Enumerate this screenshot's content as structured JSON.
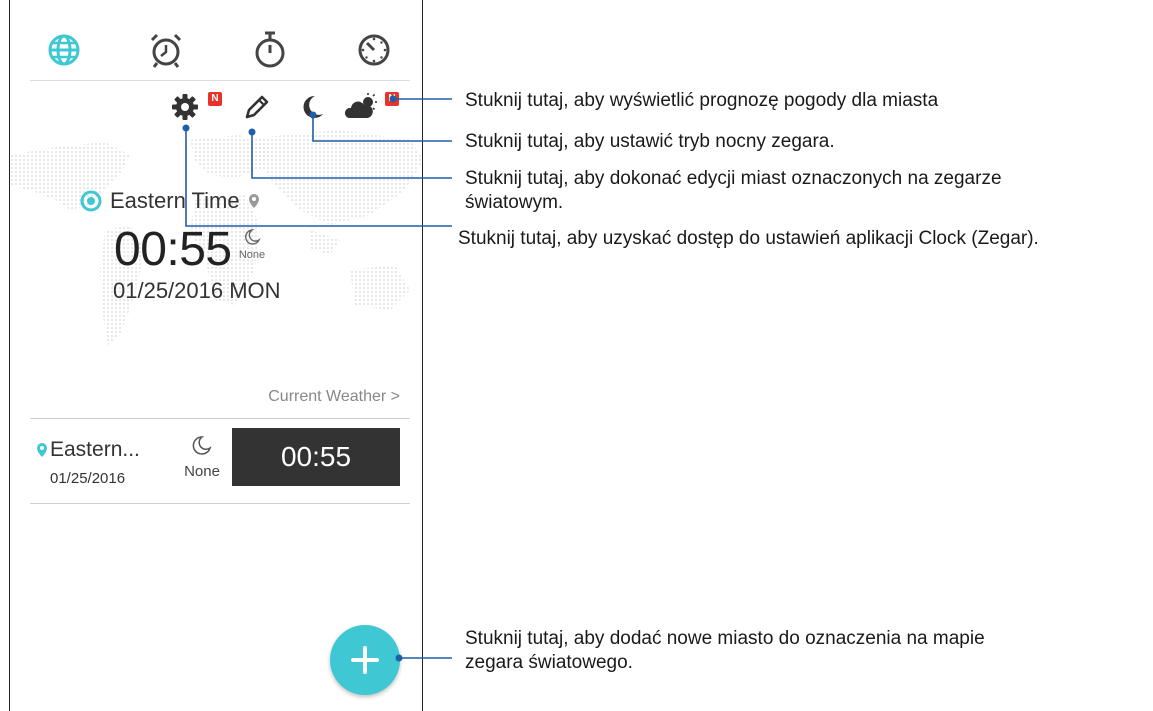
{
  "tabs": [
    {
      "name": "world-clock-tab",
      "icon": "globe-icon",
      "active": true
    },
    {
      "name": "alarm-tab",
      "icon": "alarm-clock-icon",
      "active": false
    },
    {
      "name": "stopwatch-tab",
      "icon": "stopwatch-icon",
      "active": false
    },
    {
      "name": "timer-tab",
      "icon": "timer-icon",
      "active": false
    }
  ],
  "toolbar": {
    "settings_badge": "N",
    "weather_badge": "N",
    "icons": [
      "gear-icon",
      "pencil-icon",
      "moon-icon",
      "weather-icon"
    ]
  },
  "main_clock": {
    "city": "Eastern Time",
    "time": "00:55",
    "weather": "None",
    "date": "01/25/2016 MON"
  },
  "current_weather_link": "Current Weather >",
  "city_list": [
    {
      "city": "Eastern...",
      "date": "01/25/2016",
      "weather": "None",
      "time": "00:55"
    }
  ],
  "annotations": {
    "weather": "Stuknij tutaj, aby wyświetlić prognozę pogody dla miasta",
    "night_mode": "Stuknij tutaj, aby ustawić tryb nocny zegara.",
    "edit_line1": "Stuknij tutaj, aby dokonać edycji miast oznaczonych na zegarze",
    "edit_line2": "światowym.",
    "settings": "Stuknij tutaj, aby uzyskać dostęp do ustawień aplikacji Clock (Zegar).",
    "add_line1": "Stuknij tutaj, aby dodać nowe miasto do oznaczenia na mapie",
    "add_line2": "zegara światowego."
  },
  "colors": {
    "accent": "#3fc8d3",
    "badge": "#e8332b",
    "callout_line": "#1f5fa8",
    "time_box": "#333333"
  }
}
